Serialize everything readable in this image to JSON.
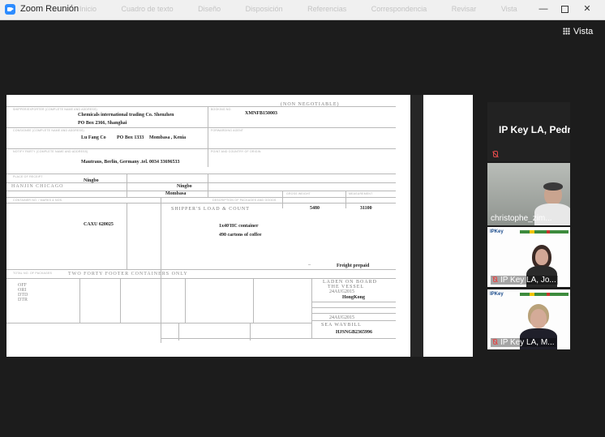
{
  "window": {
    "title": "Zoom Reunión",
    "ghost_menu": [
      "Inicio",
      "Cuadro de texto",
      "Diseño",
      "Disposición",
      "Referencias",
      "Correspondencia",
      "Revisar",
      "Vista"
    ],
    "minimize_glyph": "—",
    "close_glyph": "✕"
  },
  "view_button": {
    "label": "Vista"
  },
  "shared_document": {
    "header": "(NON NEGOTIABLE)",
    "booking_no": "XMNFB150003",
    "shipper_name": "Chemicals international trading Co. Shenzhen",
    "shipper_address": "PO Box 2366, Shanghai",
    "consignee_name": "Lu Fang Co",
    "consignee_address": "PO Box 1333",
    "consignee_city": "Mombasa , Kenia",
    "notify_party": "Mautraus, Berlin, Germany  .tel. 0034 33696533",
    "place_of_receipt": "Ningbo",
    "port_of_loading": "Ningbo",
    "port_of_discharge": "Mombasa",
    "vessel_label": "HANJIN CHICAGO",
    "description_header": "SHIPPER'S LOAD & COUNT",
    "container_no": "CAXU 620025",
    "gross_weight": "5480",
    "measurement": "31100",
    "goods_line1": "1x40'HC container",
    "goods_line2": "490 cartons  of coffee",
    "freight": "Freight prepaid",
    "containers_words": "TWO FORTY FOOTER CONTAINERS ONLY",
    "laden_on_board": "LADEN ON BOARD",
    "the_vessel": "THE VESSEL",
    "date_1": "24AUG2015",
    "place_of_issue": "HongKong",
    "date_2": "24AUG2015",
    "sea_waybill": "SEA WAYBILL",
    "bl_no": "HJSNGB2365996",
    "copies": [
      "OFF",
      "ORI",
      "DTD",
      "DTR"
    ]
  },
  "participants": [
    {
      "name": "IP Key LA, Pedr...",
      "video": false,
      "muted": true
    },
    {
      "name": "christophe_zim...",
      "video": true,
      "muted": false,
      "active": true
    },
    {
      "name": "IP Key LA, Jo...",
      "video": true,
      "muted": true
    },
    {
      "name": "IP Key LA, M...",
      "video": true,
      "muted": true
    }
  ],
  "slide_logo": "IPKey"
}
